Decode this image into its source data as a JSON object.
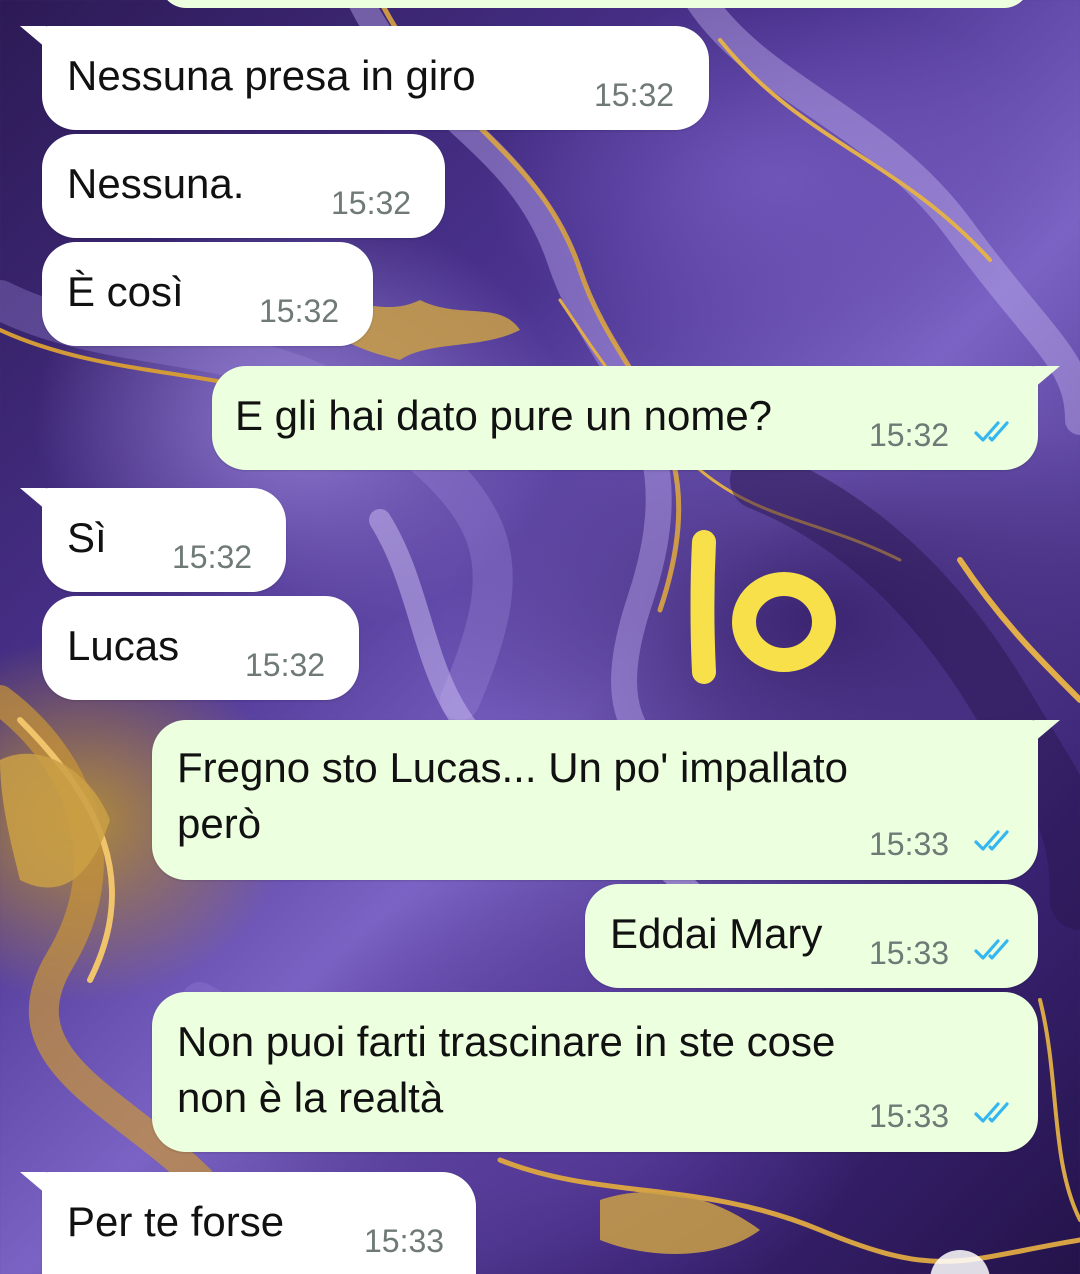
{
  "messages": [
    {
      "direction": "in",
      "text": "Nessuna presa in giro",
      "time": "15:32"
    },
    {
      "direction": "in",
      "text": "Nessuna.",
      "time": "15:32"
    },
    {
      "direction": "in",
      "text": "È così",
      "time": "15:32"
    },
    {
      "direction": "out",
      "text": "E gli hai dato pure un nome?",
      "time": "15:32",
      "status": "read"
    },
    {
      "direction": "in",
      "text": "Sì",
      "time": "15:32"
    },
    {
      "direction": "in",
      "text": "Lucas",
      "time": "15:32"
    },
    {
      "direction": "out",
      "text": "Fregno sto Lucas... Un po' impallato\nperò",
      "time": "15:33",
      "status": "read"
    },
    {
      "direction": "out",
      "text": "Eddai Mary",
      "time": "15:33",
      "status": "read"
    },
    {
      "direction": "out",
      "text": "Non puoi farti trascinare in ste cose\nnon è la realtà",
      "time": "15:33",
      "status": "read"
    },
    {
      "direction": "in",
      "text": "Per te forse",
      "time": "15:33"
    }
  ],
  "annotation": {
    "text": "Io",
    "color": "#f7e04a"
  },
  "colors": {
    "incoming_bubble": "#ffffff",
    "outgoing_bubble": "#ecffdf",
    "timestamp": "#6f7a77",
    "read_ticks": "#34b7f1"
  },
  "icons": {
    "read_receipt": "double-check-icon"
  }
}
